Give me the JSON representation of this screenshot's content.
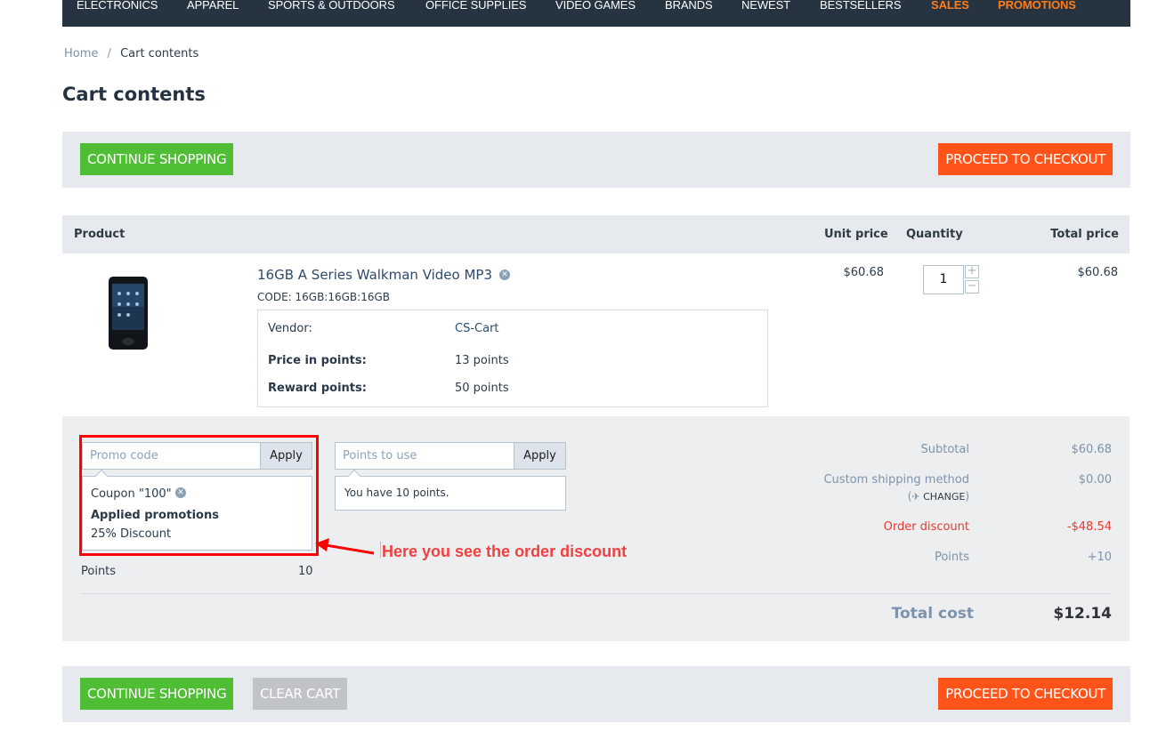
{
  "nav": {
    "items": [
      {
        "label": "ELECTRONICS",
        "highlight": false
      },
      {
        "label": "APPAREL",
        "highlight": false
      },
      {
        "label": "SPORTS & OUTDOORS",
        "highlight": false
      },
      {
        "label": "OFFICE SUPPLIES",
        "highlight": false
      },
      {
        "label": "VIDEO GAMES",
        "highlight": false
      },
      {
        "label": "BRANDS",
        "highlight": false
      },
      {
        "label": "NEWEST",
        "highlight": false
      },
      {
        "label": "BESTSELLERS",
        "highlight": false
      },
      {
        "label": "SALES",
        "highlight": true
      },
      {
        "label": "PROMOTIONS",
        "highlight": true
      }
    ]
  },
  "breadcrumb": {
    "home": "Home",
    "separator": "/",
    "current": "Cart contents"
  },
  "page_title": "Cart contents",
  "buttons": {
    "continue_shopping": "CONTINUE SHOPPING",
    "proceed_to_checkout": "PROCEED TO CHECKOUT",
    "clear_cart": "CLEAR CART"
  },
  "table": {
    "headers": {
      "product": "Product",
      "unit_price": "Unit price",
      "quantity": "Quantity",
      "total_price": "Total price"
    },
    "rows": [
      {
        "name": "16GB A Series Walkman Video MP3",
        "code": "CODE: 16GB:16GB:16GB",
        "image": "walkman-mp3-player",
        "options": [
          {
            "label": "Vendor:",
            "value": "CS-Cart"
          },
          {
            "label": "Price in points:",
            "value": "13 points"
          },
          {
            "label": "Reward points:",
            "value": "50 points"
          }
        ],
        "unit_price": "$60.68",
        "quantity": "1",
        "total_price": "$60.68"
      }
    ]
  },
  "promo": {
    "placeholder": "Promo code",
    "apply": "Apply",
    "coupon": "Coupon \"100\"",
    "applied_title": "Applied promotions",
    "applied_item": "25% Discount"
  },
  "points_use": {
    "placeholder": "Points to use",
    "apply": "Apply",
    "info": "You have 10 points."
  },
  "points_row": {
    "label": "Points",
    "value": "10"
  },
  "annotation": "Here you see the order discount",
  "summary": {
    "subtotal_label": "Subtotal",
    "subtotal_value": "$60.68",
    "shipping_label": "Custom shipping method",
    "shipping_value": "$0.00",
    "change_label": "CHANGE",
    "discount_label": "Order discount",
    "discount_value": "-$48.54",
    "points_label": "Points",
    "points_value": "+10",
    "total_label": "Total cost",
    "total_value": "$12.14"
  },
  "colors": {
    "nav_bg": "#263340",
    "nav_highlight": "#ff7c17",
    "green_button": "#4fbe34",
    "orange_button": "#ff5319",
    "grey_button": "#c1c4c7",
    "discount_red": "#e83a2c",
    "annotation_red": "#ff0000"
  }
}
